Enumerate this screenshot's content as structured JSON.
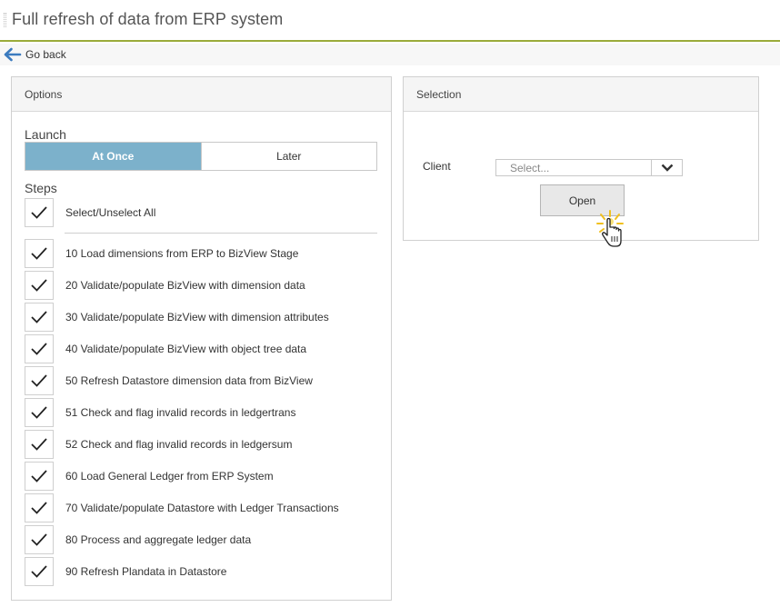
{
  "page": {
    "title": "Full refresh of data from ERP system"
  },
  "nav": {
    "back_label": "Go back",
    "back_icon": "arrow-left-icon"
  },
  "colors": {
    "accent_line": "#9aab3a",
    "active_toggle": "#7cb1cb",
    "back_arrow": "#3c7bbf"
  },
  "options": {
    "header": "Options",
    "launch": {
      "label": "Launch",
      "options": [
        {
          "label": "At Once",
          "selected": true
        },
        {
          "label": "Later",
          "selected": false
        }
      ]
    },
    "steps": {
      "label": "Steps",
      "select_all": {
        "label": "Select/Unselect All",
        "checked": true
      },
      "items": [
        {
          "label": "10 Load dimensions from ERP to BizView Stage",
          "checked": true
        },
        {
          "label": "20 Validate/populate BizView with dimension data",
          "checked": true
        },
        {
          "label": "30 Validate/populate BizView with dimension attributes",
          "checked": true
        },
        {
          "label": "40 Validate/populate BizView with object tree data",
          "checked": true
        },
        {
          "label": "50 Refresh Datastore dimension data from BizView",
          "checked": true
        },
        {
          "label": "51 Check and flag invalid records in ledgertrans",
          "checked": true
        },
        {
          "label": "52 Check and flag invalid records in ledgersum",
          "checked": true
        },
        {
          "label": "60 Load General Ledger from ERP System",
          "checked": true
        },
        {
          "label": "70 Validate/populate Datastore with Ledger Transactions",
          "checked": true
        },
        {
          "label": "80 Process and aggregate ledger data",
          "checked": true
        },
        {
          "label": "90 Refresh Plandata in Datastore",
          "checked": true
        }
      ]
    }
  },
  "selection": {
    "header": "Selection",
    "client": {
      "label": "Client",
      "placeholder": "Select..."
    },
    "open_label": "Open"
  }
}
